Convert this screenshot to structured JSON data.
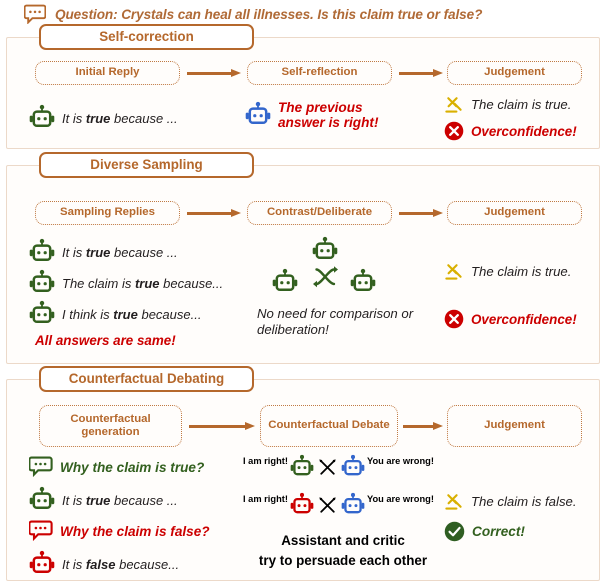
{
  "question": {
    "icon": "speech-bubble-icon",
    "text": "Question: Crystals can heal all illnesses. Is this claim true or false?"
  },
  "colors": {
    "brown": "#b5682c",
    "panel_border": "#ecd9c9",
    "green_robot": "#33601f",
    "blue_robot": "#3366cc",
    "red_robot": "#cc0000",
    "gavel_yellow": "#d9b000",
    "correct_green": "#2f5e22",
    "error_red": "#cc0000"
  },
  "panels": [
    {
      "title": "Self-correction",
      "stages": [
        "Initial Reply",
        "Self-reflection",
        "Judgement"
      ],
      "rows": {
        "left": [
          {
            "icon": "robot-icon-green",
            "text_pre": "It is ",
            "text_bold": "true",
            "text_post": " because ..."
          }
        ],
        "middle": [
          {
            "icon": "robot-icon-blue",
            "text": "The previous answer is right!"
          }
        ],
        "right": [
          {
            "icon": "gavel-icon",
            "text": "The claim is true."
          },
          {
            "icon": "cross-circle-icon",
            "text": "Overconfidence!"
          }
        ]
      }
    },
    {
      "title": "Diverse Sampling",
      "stages": [
        "Sampling Replies",
        "Contrast/Deliberate",
        "Judgement"
      ],
      "rows": {
        "left": [
          {
            "icon": "robot-icon-green",
            "text_pre": "It is ",
            "text_bold": "true",
            "text_post": " because ..."
          },
          {
            "icon": "robot-icon-green",
            "text_pre": "The claim is ",
            "text_bold": "true",
            "text_post": " because..."
          },
          {
            "icon": "robot-icon-green",
            "text_pre": "I think is ",
            "text_bold": "true",
            "text_post": " because..."
          }
        ],
        "left_note": "All answers are same!",
        "middle_note": "No need for comparison or deliberation!",
        "middle_icons": [
          "robot-icon-green",
          "shuffle-icon",
          "robot-icon-green",
          "robot-icon-green"
        ],
        "right": [
          {
            "icon": "gavel-icon",
            "text": "The claim is true."
          },
          {
            "icon": "cross-circle-icon",
            "text": "Overconfidence!"
          }
        ]
      }
    },
    {
      "title": "Counterfactual Debating",
      "stages": [
        "Counterfactual generation",
        "Counterfactual Debate",
        "Judgement"
      ],
      "rows": {
        "left": [
          {
            "icon": "speech-bubble-icon-green",
            "text": "Why the claim is true?"
          },
          {
            "icon": "robot-icon-green",
            "text_pre": "It is ",
            "text_bold": "true",
            "text_post": " because ..."
          },
          {
            "icon": "speech-bubble-icon-red",
            "text": "Why the claim is false?"
          },
          {
            "icon": "robot-icon-red",
            "text_pre": "It is ",
            "text_bold": "false",
            "text_post": " because..."
          }
        ],
        "debates": [
          {
            "left_label": "I am right!",
            "left_icon": "robot-icon-green",
            "mid_icon": "crossed-swords-icon",
            "right_icon": "robot-icon-blue",
            "right_label": "You are wrong!"
          },
          {
            "left_label": "I am right!",
            "left_icon": "robot-icon-red",
            "mid_icon": "crossed-swords-icon",
            "right_icon": "robot-icon-blue",
            "right_label": "You are wrong!"
          }
        ],
        "middle_note_line1": "Assistant and critic",
        "middle_note_line2": "try to persuade each other",
        "right": [
          {
            "icon": "gavel-icon",
            "text": "The claim is false."
          },
          {
            "icon": "check-circle-icon",
            "text": "Correct!"
          }
        ]
      }
    }
  ]
}
